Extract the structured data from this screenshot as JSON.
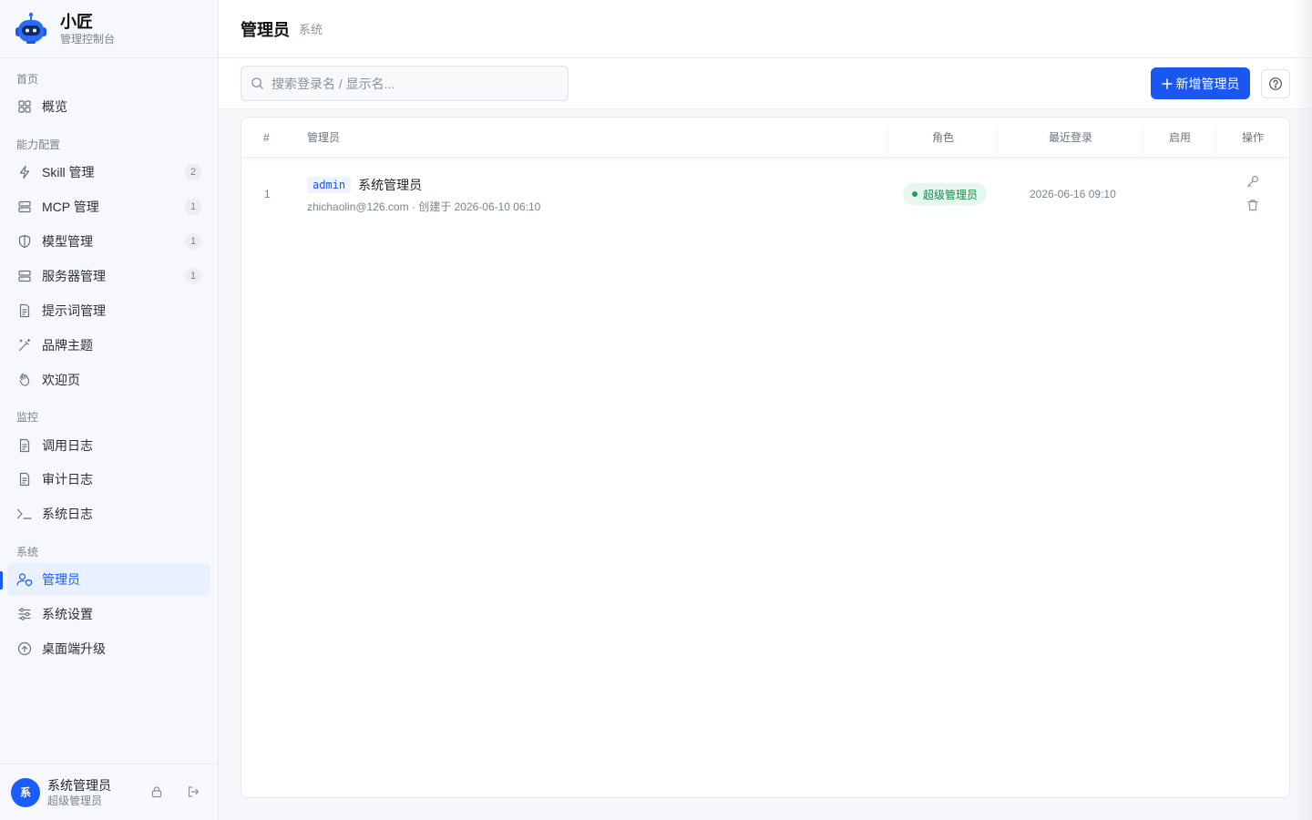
{
  "brand": {
    "name": "小匠",
    "subtitle": "管理控制台"
  },
  "sidebar": {
    "groups": [
      {
        "label": "首页",
        "items": [
          {
            "label": "概览",
            "icon": "grid-icon"
          }
        ]
      },
      {
        "label": "能力配置",
        "items": [
          {
            "label": "Skill 管理",
            "icon": "lightning-icon",
            "count": "2"
          },
          {
            "label": "MCP 管理",
            "icon": "server-icon",
            "count": "1"
          },
          {
            "label": "模型管理",
            "icon": "shield-icon",
            "count": "1"
          },
          {
            "label": "服务器管理",
            "icon": "server-icon",
            "count": "1"
          },
          {
            "label": "提示词管理",
            "icon": "document-icon"
          },
          {
            "label": "品牌主题",
            "icon": "magic-wand-icon"
          },
          {
            "label": "欢迎页",
            "icon": "hand-wave-icon"
          }
        ]
      },
      {
        "label": "监控",
        "items": [
          {
            "label": "调用日志",
            "icon": "document-icon"
          },
          {
            "label": "审计日志",
            "icon": "document-icon"
          },
          {
            "label": "系统日志",
            "icon": "terminal-icon"
          }
        ]
      },
      {
        "label": "系统",
        "items": [
          {
            "label": "管理员",
            "icon": "user-shield-icon",
            "active": true
          },
          {
            "label": "系统设置",
            "icon": "sliders-icon"
          },
          {
            "label": "桌面端升级",
            "icon": "upgrade-icon"
          }
        ]
      }
    ]
  },
  "user": {
    "avatar_text": "系",
    "name": "系统管理员",
    "role": "超级管理员"
  },
  "header": {
    "title": "管理员",
    "crumb": "系统"
  },
  "toolbar": {
    "search_placeholder": "搜索登录名 / 显示名...",
    "add_label": "新增管理员"
  },
  "table": {
    "columns": [
      "#",
      "管理员",
      "角色",
      "最近登录",
      "启用",
      "操作"
    ],
    "rows": [
      {
        "index": "1",
        "login": "admin",
        "display_name": "系统管理员",
        "meta": "zhichaolin@126.com · 创建于 2026-06-10 06:10",
        "role": "超级管理员",
        "last_login": "2026-06-16 09:10"
      }
    ]
  },
  "colors": {
    "accent": "#1a56f0",
    "success": "#1a8a4a"
  }
}
